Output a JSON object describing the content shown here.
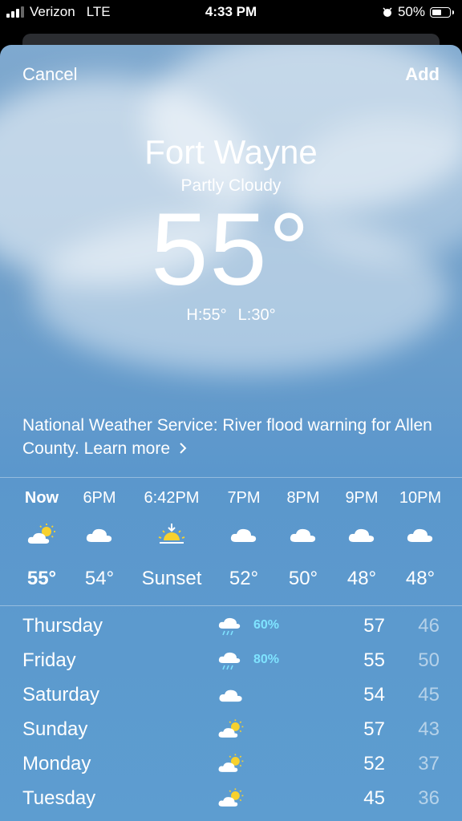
{
  "status_bar": {
    "carrier": "Verizon",
    "network": "LTE",
    "time": "4:33 PM",
    "battery": "50%"
  },
  "header": {
    "cancel_label": "Cancel",
    "add_label": "Add"
  },
  "current": {
    "city": "Fort Wayne",
    "condition": "Partly Cloudy",
    "temp": "55°",
    "high": "H:55°",
    "low": "L:30°"
  },
  "alert": {
    "text": "National Weather Service: River flood warning for Allen County. Learn more"
  },
  "hourly": [
    {
      "label": "Now",
      "icon": "partly-sunny-icon",
      "value": "55°"
    },
    {
      "label": "6PM",
      "icon": "cloud-icon",
      "value": "54°"
    },
    {
      "label": "6:42PM",
      "icon": "sunset-icon",
      "value": "Sunset"
    },
    {
      "label": "7PM",
      "icon": "cloud-icon",
      "value": "52°"
    },
    {
      "label": "8PM",
      "icon": "cloud-icon",
      "value": "50°"
    },
    {
      "label": "9PM",
      "icon": "cloud-icon",
      "value": "48°"
    },
    {
      "label": "10PM",
      "icon": "cloud-icon",
      "value": "48°"
    }
  ],
  "daily": [
    {
      "day": "Thursday",
      "icon": "rain-cloud-icon",
      "precip": "60%",
      "high": "57",
      "low": "46"
    },
    {
      "day": "Friday",
      "icon": "rain-cloud-icon",
      "precip": "80%",
      "high": "55",
      "low": "50"
    },
    {
      "day": "Saturday",
      "icon": "cloud-icon",
      "precip": "",
      "high": "54",
      "low": "45"
    },
    {
      "day": "Sunday",
      "icon": "partly-sunny-icon",
      "precip": "",
      "high": "57",
      "low": "43"
    },
    {
      "day": "Monday",
      "icon": "partly-sunny-icon",
      "precip": "",
      "high": "52",
      "low": "37"
    },
    {
      "day": "Tuesday",
      "icon": "partly-sunny-icon",
      "precip": "",
      "high": "45",
      "low": "36"
    }
  ],
  "colors": {
    "precip": "#7fe3ff",
    "sun": "#f7d12e"
  }
}
